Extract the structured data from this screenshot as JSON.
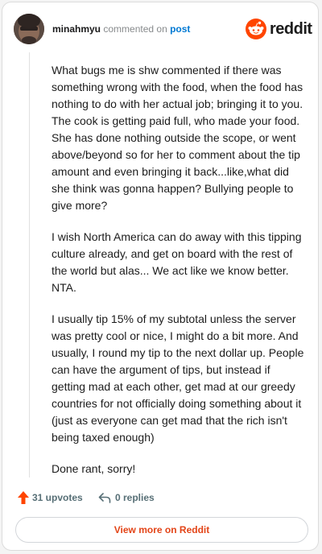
{
  "header": {
    "username": "minahmyu",
    "commented_on": "commented on",
    "post_link": "post",
    "brand": "reddit"
  },
  "comment": {
    "paragraphs": [
      "What bugs me is shw commented if there was something wrong with the food, when the food has nothing to do with her actual job; bringing it to you. The cook is getting paid full, who made your food. She has done nothing outside the scope, or went above/beyond so for her to comment about the tip amount and even bringing it back...like,what did she think was gonna happen? Bullying people to give more?",
      "I wish North America can do away with this tipping culture already, and get on board with the rest of the world but alas... We act like we know better. NTA.",
      "I usually tip 15% of my subtotal unless the server was pretty cool or nice, I might do a bit more. And usually, I round my tip to the next dollar up. People can have the argument of tips, but instead if getting mad at each other, get mad at our greedy countries for not officially doing something about it (just as everyone can get mad that the rich isn't being taxed enough)",
      "Done rant, sorry!"
    ]
  },
  "actions": {
    "upvotes": "31 upvotes",
    "replies": "0 replies"
  },
  "footer": {
    "view_more": "View more on Reddit"
  },
  "colors": {
    "accent": "#ff4500",
    "link": "#0079d3",
    "button_text": "#e34417"
  }
}
